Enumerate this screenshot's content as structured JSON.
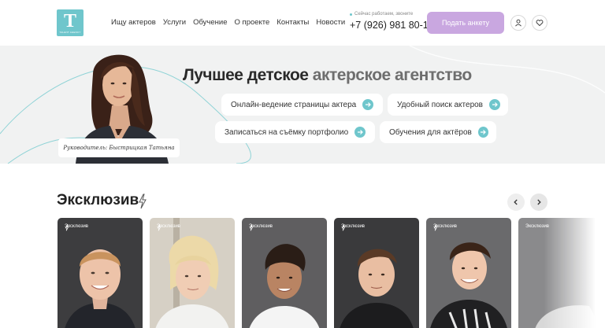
{
  "header": {
    "logo_letter": "T",
    "logo_sub": "TALENT AGENCY",
    "nav": [
      "Ищу актеров",
      "Услуги",
      "Обучение",
      "О проекте",
      "Контакты",
      "Новости"
    ],
    "phone_note": "Сейчас работаем, звоните",
    "phone": "+7 (926) 981 80-12",
    "apply_label": "Подать анкету",
    "icons": [
      "user-icon",
      "heart-icon"
    ]
  },
  "hero": {
    "title_main": "Лучшее детское ",
    "title_accent": "актерское агентство",
    "caption": "Руководитель: Быстрицкая Татьяна",
    "pills": [
      "Онлайн-ведение страницы актера",
      "Удобный поиск актеров",
      "Записаться на съёмку портфолио",
      "Обучения для актёров"
    ]
  },
  "exclusive": {
    "title": "Эксклюзив",
    "badge": "Эксклюзив",
    "icons": [
      "lightning-icon",
      "chevron-left-icon",
      "chevron-right-icon"
    ]
  },
  "colors": {
    "accent": "#6fc6cc",
    "button": "#c9a7e0",
    "hero_bg": "#f1f2f2"
  }
}
